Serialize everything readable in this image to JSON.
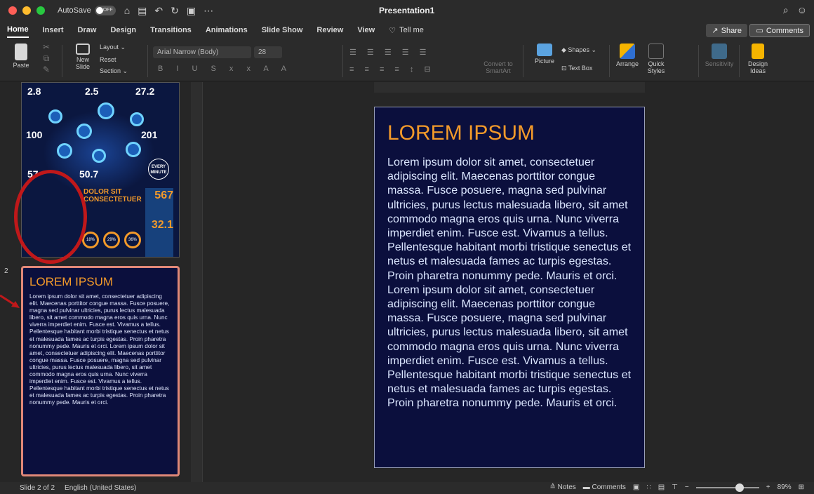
{
  "window": {
    "autosave_label": "AutoSave",
    "autosave_state": "OFF",
    "title": "Presentation1"
  },
  "tabs": [
    {
      "label": "Home",
      "active": true
    },
    {
      "label": "Insert"
    },
    {
      "label": "Draw"
    },
    {
      "label": "Design"
    },
    {
      "label": "Transitions"
    },
    {
      "label": "Animations"
    },
    {
      "label": "Slide Show"
    },
    {
      "label": "Review"
    },
    {
      "label": "View"
    }
  ],
  "tellme": "Tell me",
  "share_label": "Share",
  "comments_label": "Comments",
  "ribbon": {
    "paste": "Paste",
    "new_slide": "New Slide",
    "layout": "Layout",
    "reset": "Reset",
    "section": "Section",
    "font_name": "Arial Narrow (Body)",
    "font_size": "28",
    "convert_smartart": "Convert to SmartArt",
    "picture": "Picture",
    "shapes": "Shapes",
    "text_box": "Text Box",
    "arrange": "Arrange",
    "quick_styles": "Quick Styles",
    "sensitivity": "Sensitivity",
    "design_ideas": "Design Ideas"
  },
  "slides_panel": {
    "slide1": {
      "stats": [
        "2.8",
        "2.5",
        "27.2",
        "100",
        "201",
        "57",
        "50.7"
      ],
      "heading": "DOLOR SIT CONSECTETUER",
      "orange_stats": [
        "567",
        "32.1"
      ],
      "every_minute": "EVERY MINUTE",
      "rings": [
        "18%",
        "29%",
        "36%"
      ]
    },
    "slide2_number": "2",
    "slide2": {
      "title": "LOREM IPSUM",
      "body": "Lorem ipsum dolor sit amet, consectetuer adipiscing elit. Maecenas porttitor congue massa. Fusce posuere, magna sed pulvinar ultricies, purus lectus malesuada libero, sit amet commodo magna eros quis urna. Nunc viverra imperdiet enim. Fusce est. Vivamus a tellus. Pellentesque habitant morbi tristique senectus et netus et malesuada fames ac turpis egestas. Proin pharetra nonummy pede. Mauris et orci. Lorem ipsum dolor sit amet, consectetuer adipiscing elit. Maecenas porttitor congue massa. Fusce posuere, magna sed pulvinar ultricies, purus lectus malesuada libero, sit amet commodo magna eros quis urna. Nunc viverra imperdiet enim. Fusce est. Vivamus a tellus. Pellentesque habitant morbi tristique senectus et netus et malesuada fames ac turpis egestas. Proin pharetra nonummy pede. Mauris et orci."
    }
  },
  "main_slide": {
    "title": "LOREM IPSUM",
    "body": "Lorem ipsum dolor sit amet, consectetuer adipiscing elit. Maecenas porttitor congue massa. Fusce posuere, magna sed pulvinar ultricies, purus lectus malesuada libero, sit amet commodo magna eros quis urna. Nunc viverra imperdiet enim. Fusce est. Vivamus a tellus. Pellentesque habitant morbi tristique senectus et netus et malesuada fames ac turpis egestas. Proin pharetra nonummy pede. Mauris et orci. Lorem ipsum dolor sit amet, consectetuer adipiscing elit. Maecenas porttitor congue massa. Fusce posuere, magna sed pulvinar ultricies, purus lectus malesuada libero, sit amet commodo magna eros quis urna. Nunc viverra imperdiet enim. Fusce est. Vivamus a tellus. Pellentesque habitant morbi tristique senectus et netus et malesuada fames ac turpis egestas. Proin pharetra nonummy pede. Mauris et orci."
  },
  "status": {
    "slide_pos": "Slide 2 of 2",
    "language": "English (United States)",
    "notes": "Notes",
    "comments": "Comments",
    "zoom": "89%"
  },
  "colors": {
    "slide_bg": "#0b0f3d",
    "accent_orange": "#f39a2a",
    "annotation_red": "#c0181a"
  }
}
